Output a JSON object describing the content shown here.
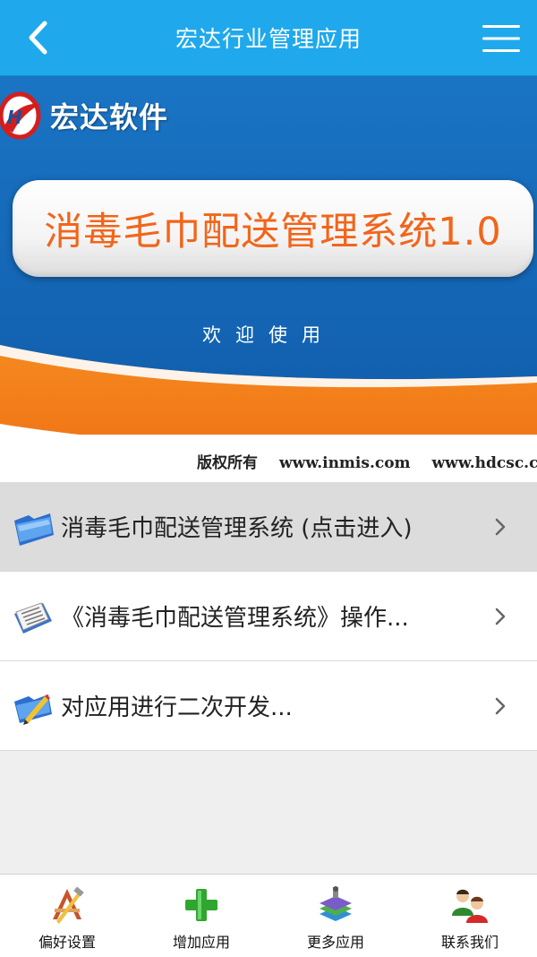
{
  "header": {
    "title": "宏达行业管理应用",
    "back_icon": "chevron-left-icon",
    "menu_icon": "hamburger-menu-icon"
  },
  "banner": {
    "brand_text": "宏达软件",
    "system_title": "消毒毛巾配送管理系统1.0",
    "welcome": "欢迎使用",
    "copyright_label": "版权所有",
    "url_1": "www.inmis.com",
    "url_2": "www.hdcsc.com"
  },
  "list": {
    "items": [
      {
        "label": "消毒毛巾配送管理系统 (点击进入)",
        "icon": "folder-icon"
      },
      {
        "label": "《消毒毛巾配送管理系统》操作...",
        "icon": "newspaper-icon"
      },
      {
        "label": "对应用进行二次开发...",
        "icon": "folder-edit-icon"
      }
    ]
  },
  "tabbar": {
    "tabs": [
      {
        "label": "偏好设置",
        "icon": "preferences-icon"
      },
      {
        "label": "增加应用",
        "icon": "add-icon"
      },
      {
        "label": "更多应用",
        "icon": "books-icon"
      },
      {
        "label": "联系我们",
        "icon": "contacts-icon"
      }
    ]
  },
  "colors": {
    "header_bg": "#1fa9ec",
    "banner_blue": "#1667b8",
    "banner_orange": "#f27a1a",
    "title_orange": "#f2651a",
    "active_row": "#dcdcdc",
    "page_bg": "#efefef"
  }
}
